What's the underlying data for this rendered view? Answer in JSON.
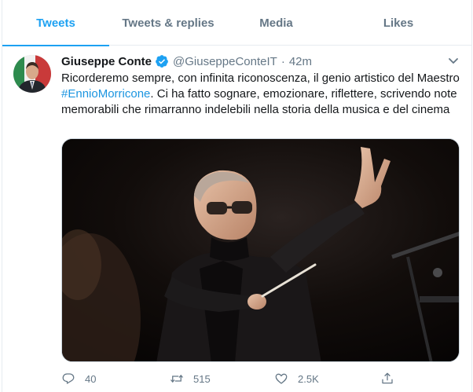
{
  "tabs": [
    {
      "label": "Tweets",
      "active": true
    },
    {
      "label": "Tweets & replies",
      "active": false
    },
    {
      "label": "Media",
      "active": false
    },
    {
      "label": "Likes",
      "active": false
    }
  ],
  "tweet": {
    "author_name": "Giuseppe Conte",
    "handle": "@GiuseppeConteIT",
    "separator": "·",
    "time": "42m",
    "text_before": "Ricorderemo sempre, con infinita riconoscenza, il genio artistico del Maestro ",
    "hashtag": "#EnnioMorricone",
    "text_after": ". Ci ha fatto sognare, emozionare, riflettere, scrivendo note memorabili che rimarranno indelebili nella storia della musica e del cinema"
  },
  "actions": {
    "replies": "40",
    "retweets": "515",
    "likes": "2.5K"
  },
  "icons": {
    "verified": "verified-badge-icon",
    "more": "chevron-down-icon",
    "reply": "reply-icon",
    "retweet": "retweet-icon",
    "like": "heart-icon",
    "share": "share-icon"
  },
  "colors": {
    "accent": "#1da1f2",
    "muted": "#657786",
    "text": "#14171a",
    "link": "#1b95e0"
  }
}
